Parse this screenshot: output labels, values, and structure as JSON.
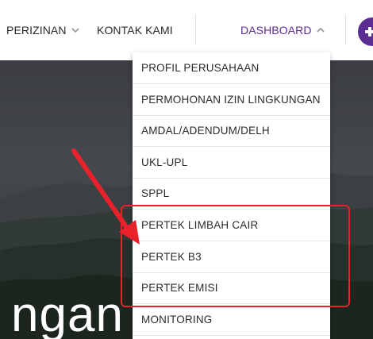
{
  "nav": {
    "items": [
      {
        "label": "PERIZINAN",
        "has_dropdown": true
      },
      {
        "label": "KONTAK KAMI",
        "has_dropdown": false
      },
      {
        "label": "DASHBOARD",
        "has_dropdown": true,
        "expanded": true
      }
    ],
    "accent_color": "#5b2d91",
    "plus_icon": "plus-icon"
  },
  "hero": {
    "text": "ngan"
  },
  "dropdown": {
    "items": [
      {
        "label": "PROFIL PERUSAHAAN"
      },
      {
        "label": "PERMOHONAN IZIN LINGKUNGAN"
      },
      {
        "label": "AMDAL/ADENDUM/DELH"
      },
      {
        "label": "UKL-UPL"
      },
      {
        "label": "SPPL"
      },
      {
        "label": "PERTEK LIMBAH CAIR"
      },
      {
        "label": "PERTEK B3"
      },
      {
        "label": "PERTEK EMISI"
      },
      {
        "label": "MONITORING"
      }
    ],
    "highlighted": [
      "PERTEK LIMBAH CAIR",
      "PERTEK B3",
      "PERTEK EMISI"
    ]
  },
  "annotation": {
    "color": "#e8212b"
  }
}
